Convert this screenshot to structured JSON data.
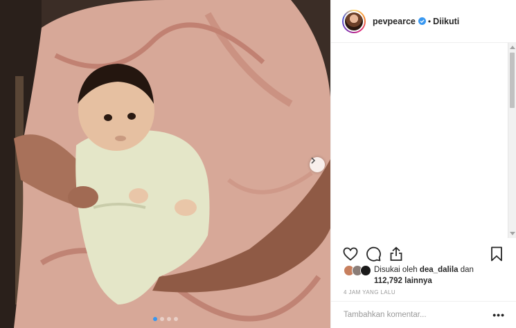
{
  "post": {
    "username": "pevpearce",
    "separator": "•",
    "follow_status": "Diikuti",
    "likes_prefix": "Disukai oleh",
    "liked_by": "dea_dalila",
    "likes_conjunction": "dan",
    "likes_count": "112,792 lainnya",
    "timestamp": "4 JAM YANG LALU",
    "comment_placeholder": "Tambahkan komentar...",
    "more_options": "•••",
    "carousel_total": 4,
    "carousel_current": 1
  },
  "icons": {
    "verified": "verified-badge-icon",
    "like": "heart-icon",
    "comment": "comment-icon",
    "share": "share-icon",
    "save": "bookmark-icon",
    "next": "chevron-right-icon"
  },
  "colors": {
    "text": "#262626",
    "muted": "#999999",
    "border": "#efefef",
    "verified": "#3897f0",
    "active_dot": "#3897f0"
  }
}
